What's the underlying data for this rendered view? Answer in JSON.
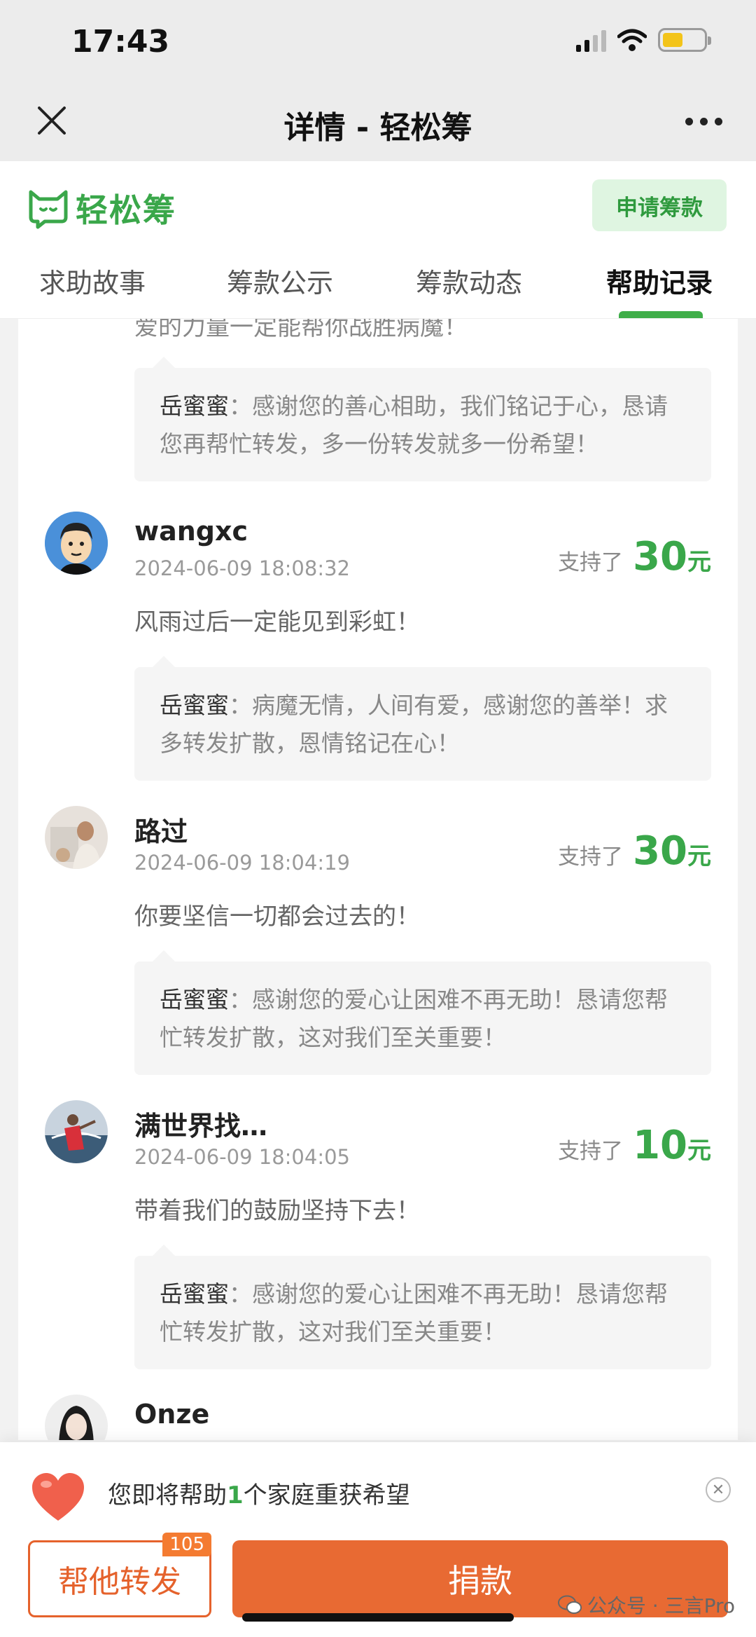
{
  "status_bar": {
    "time": "17:43"
  },
  "nav": {
    "title": "详情 - 轻松筹"
  },
  "header": {
    "brand": "轻松筹",
    "apply_button": "申请筹款"
  },
  "tabs": [
    "求助故事",
    "筹款公示",
    "筹款动态",
    "帮助记录"
  ],
  "feed": {
    "partial_top_text": "爱的力量一定能帮你战胜病魔！",
    "first_reply": {
      "author": "岳蜜蜜",
      "text": "：感谢您的善心相助，我们铭记于心，恳请您再帮忙转发，多一份转发就多一份希望！"
    },
    "support_label": "支持了",
    "unit": "元",
    "records": [
      {
        "name": "wangxc",
        "time": "2024-06-09 18:08:32",
        "amount": "30",
        "message": "风雨过后一定能见到彩虹！",
        "reply_author": "岳蜜蜜",
        "reply": "：病魔无情，人间有爱，感谢您的善举！求多转发扩散，恩情铭记在心！"
      },
      {
        "name": "路过",
        "time": "2024-06-09 18:04:19",
        "amount": "30",
        "message": "你要坚信一切都会过去的！",
        "reply_author": "岳蜜蜜",
        "reply": "：感谢您的爱心让困难不再无助！恳请您帮忙转发扩散，这对我们至关重要！"
      },
      {
        "name": "满世界找…",
        "time": "2024-06-09 18:04:05",
        "amount": "10",
        "message": "带着我们的鼓励坚持下去！",
        "reply_author": "岳蜜蜜",
        "reply": "：感谢您的爱心让困难不再无助！恳请您帮忙转发扩散，这对我们至关重要！"
      },
      {
        "name": "Onze"
      }
    ]
  },
  "bottom": {
    "hope_prefix": "您即将帮助",
    "hope_count": "1",
    "hope_suffix": "个家庭重获希望",
    "share_label": "帮他转发",
    "share_badge": "105",
    "donate_label": "捐款",
    "watermark": "公众号 · 三言Pro"
  },
  "colors": {
    "brand_green": "#3aa74a",
    "donate_orange": "#e86a33"
  }
}
